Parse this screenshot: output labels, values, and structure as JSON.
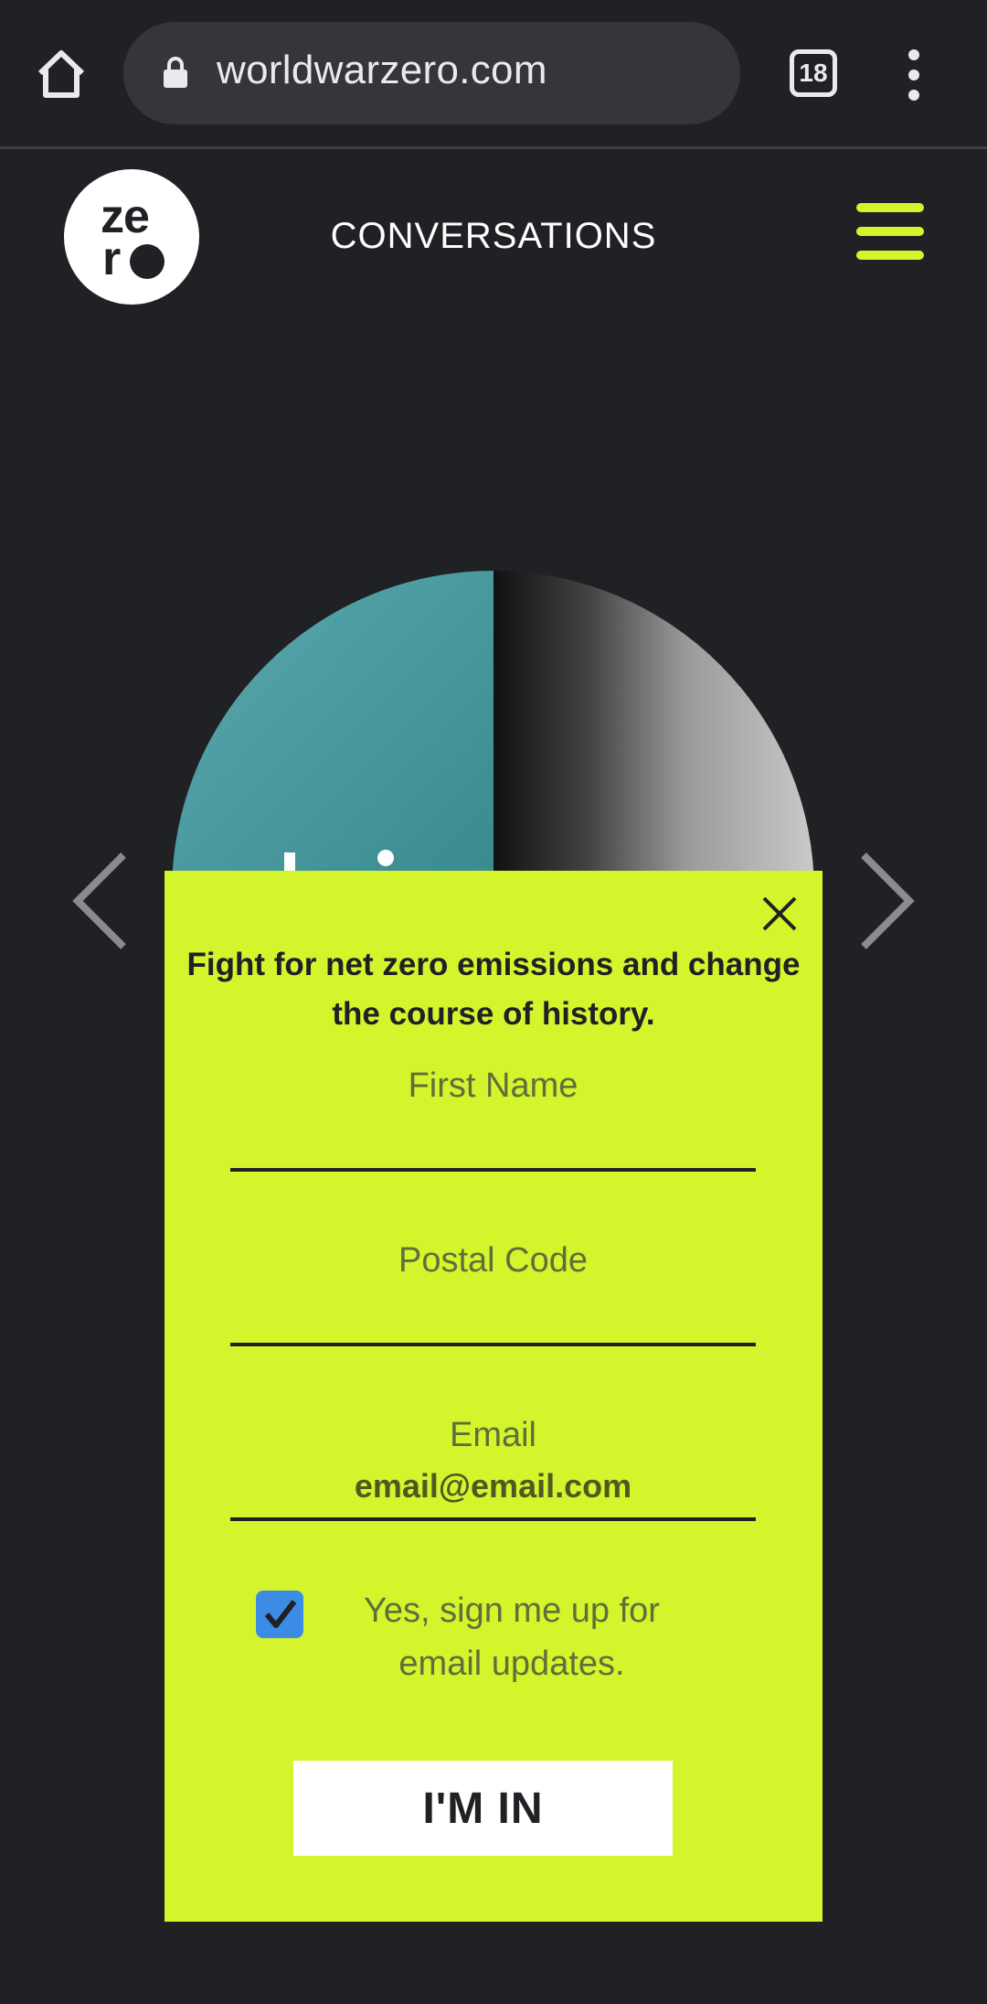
{
  "browser": {
    "url": "worldwarzero.com",
    "tab_count": "18"
  },
  "header": {
    "logo_top": "ze",
    "logo_bottom": "r",
    "nav_title": "CONVERSATIONS"
  },
  "modal": {
    "headline": "Fight for net zero emissions and change the course of history.",
    "fields": [
      {
        "label": "First Name",
        "value": "",
        "placeholder": ""
      },
      {
        "label": "Postal Code",
        "value": "",
        "placeholder": ""
      },
      {
        "label": "Email",
        "value": "",
        "placeholder": "email@email.com"
      }
    ],
    "consent_text": "Yes, sign me up for email updates.",
    "consent_checked": true,
    "submit_label": "I'M IN"
  },
  "colors": {
    "background": "#202124",
    "accent": "#d4f42c",
    "checkbox": "#3c8ce6"
  }
}
